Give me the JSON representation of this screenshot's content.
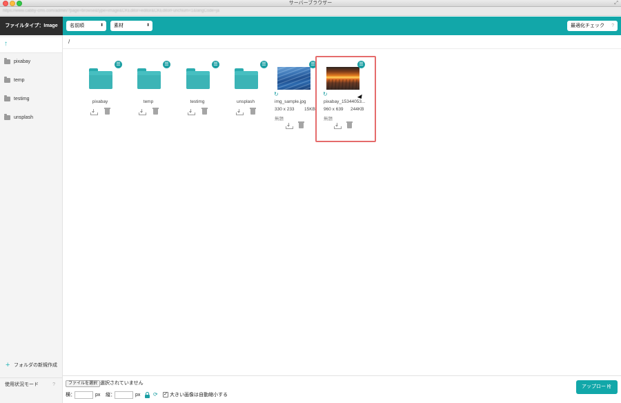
{
  "window": {
    "title": "サーバーブラウザー",
    "url_blurred": "https://www.cabby-cms.com/admin/?page=browse&type=image&CKEditor=editor&CKEditorFuncNum=1&langCode=ja"
  },
  "header": {
    "file_type_label": "ファイルタイプ：Image",
    "sort_select": "名前順",
    "source_select": "素材",
    "optimize_check": "最適化チェック",
    "optimize_help": "?"
  },
  "sidebar": {
    "up_arrow": "↑",
    "folders": [
      {
        "label": "pixabay"
      },
      {
        "label": "temp"
      },
      {
        "label": "testimg"
      },
      {
        "label": "unsplash"
      }
    ],
    "new_folder_label": "フォルダの新規作成",
    "usage_mode_label": "使用状況モード",
    "usage_help": "?"
  },
  "path": {
    "current": "/"
  },
  "items": {
    "folders": [
      {
        "name": "pixabay"
      },
      {
        "name": "temp"
      },
      {
        "name": "testimg"
      },
      {
        "name": "unsplash"
      }
    ],
    "images": [
      {
        "name": "img_sample.jpg",
        "dimensions": "330 x 233",
        "size": "15KB",
        "caption": "無題"
      },
      {
        "name": "pixabay_15344053...",
        "dimensions": "960 x 639",
        "size": "244KB",
        "caption": "無題"
      }
    ],
    "selected_index": 1
  },
  "footer": {
    "choose_file_label": "ファイルを選択",
    "no_file_label": "選択されていません",
    "width_label": "横：",
    "height_label": "縦：",
    "px_unit": "px",
    "auto_shrink_label": "大きい画像は自動縮小する",
    "auto_shrink_checked": true,
    "upload_label": "アップロード"
  },
  "colors": {
    "accent": "#12a7a9",
    "dark_header": "#2d2d2d",
    "selection_border": "#e56b6b"
  }
}
